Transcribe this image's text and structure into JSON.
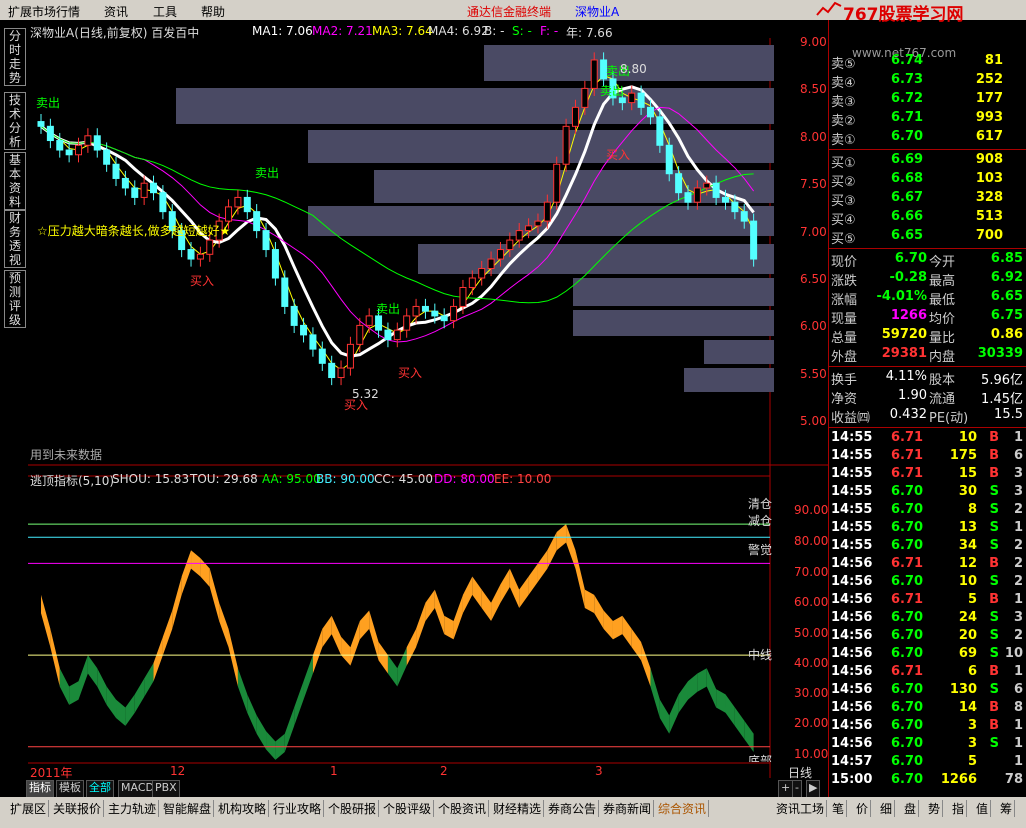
{
  "menu": {
    "items": [
      "扩展市场行情",
      "资讯",
      "工具",
      "帮助"
    ],
    "app_title": "通达信金融终端",
    "stock": "深物业A"
  },
  "logo": {
    "text": "767股票学习网",
    "url": "www.net767.com"
  },
  "side_tabs": [
    "分时走势",
    "技术分析",
    "基本资料",
    "财务透视",
    "预测评级"
  ],
  "chart_header": {
    "title": "深物业A(日线,前复权) 百发百中",
    "ma1": "MA1: 7.06",
    "ma2": "MA2: 7.21",
    "ma3": "MA3: 7.64",
    "ma4": "MA4: 6.92",
    "b": "B: -",
    "s": "S: -",
    "f": "F: -",
    "nian": "年: 7.66"
  },
  "price_axis": [
    "9.00",
    "8.50",
    "8.00",
    "7.50",
    "7.00",
    "6.50",
    "6.00",
    "5.50",
    "5.00"
  ],
  "chart_annotations": {
    "pressure_text": "☆压力越大暗条越长,做多越短越好★",
    "future_data": "用到未来数据",
    "sell": "卖出",
    "buy": "买入",
    "low_price": "5.32",
    "high_price": "8.80"
  },
  "indicator": {
    "header": "逃顶指标(5,10)",
    "shou": "SHOU: 15.83",
    "tou": "TOU: 29.68",
    "aa": "AA: 95.00",
    "bb": "BB: 90.00",
    "cc": "CC: 45.00",
    "dd": "DD: 80.00",
    "ee": "EE: 10.00",
    "levels": [
      "清仓",
      "减仓",
      "警觉",
      "中线",
      "底部"
    ],
    "axis": [
      "90.00",
      "80.00",
      "70.00",
      "60.00",
      "50.00",
      "40.00",
      "30.00",
      "20.00",
      "10.00"
    ]
  },
  "x_axis": {
    "labels": [
      "2011年",
      "12",
      "1",
      "2",
      "3"
    ],
    "period": "日线"
  },
  "bottom_tabs": [
    "指标",
    "模板",
    "全部",
    "MACD",
    "PBX"
  ],
  "footer": [
    "扩展区",
    "关联报价",
    "主力轨迹",
    "智能解盘",
    "机构攻略",
    "行业攻略",
    "个股研报",
    "个股评级",
    "个股资讯",
    "财经精选",
    "券商公告",
    "券商新闻",
    "综合资讯",
    "资讯工场"
  ],
  "footer_right": [
    "笔",
    "价",
    "细",
    "盘",
    "势",
    "指",
    "值",
    "筹"
  ],
  "order_book": {
    "asks": [
      {
        "label": "卖⑤",
        "price": "6.74",
        "vol": "81"
      },
      {
        "label": "卖④",
        "price": "6.73",
        "vol": "252"
      },
      {
        "label": "卖③",
        "price": "6.72",
        "vol": "177"
      },
      {
        "label": "卖②",
        "price": "6.71",
        "vol": "993"
      },
      {
        "label": "卖①",
        "price": "6.70",
        "vol": "617"
      }
    ],
    "bids": [
      {
        "label": "买①",
        "price": "6.69",
        "vol": "908"
      },
      {
        "label": "买②",
        "price": "6.68",
        "vol": "103"
      },
      {
        "label": "买③",
        "price": "6.67",
        "vol": "328"
      },
      {
        "label": "买④",
        "price": "6.66",
        "vol": "513"
      },
      {
        "label": "买⑤",
        "price": "6.65",
        "vol": "700"
      }
    ]
  },
  "stats": [
    {
      "l1": "现价",
      "v1": "6.70",
      "c1": "#0f0",
      "l2": "今开",
      "v2": "6.85",
      "c2": "#0f0"
    },
    {
      "l1": "涨跌",
      "v1": "-0.28",
      "c1": "#0f0",
      "l2": "最高",
      "v2": "6.92",
      "c2": "#0f0"
    },
    {
      "l1": "涨幅",
      "v1": "-4.01%",
      "c1": "#0f0",
      "l2": "最低",
      "v2": "6.65",
      "c2": "#0f0"
    },
    {
      "l1": "现量",
      "v1": "1266",
      "c1": "#f0f",
      "l2": "均价",
      "v2": "6.75",
      "c2": "#0f0"
    },
    {
      "l1": "总量",
      "v1": "59720",
      "c1": "#ff0",
      "l2": "量比",
      "v2": "0.86",
      "c2": "#ff0"
    },
    {
      "l1": "外盘",
      "v1": "29381",
      "c1": "#f33",
      "l2": "内盘",
      "v2": "30339",
      "c2": "#0f0"
    }
  ],
  "stats2": [
    {
      "l1": "换手",
      "v1": "4.11%",
      "l2": "股本",
      "v2": "5.96亿"
    },
    {
      "l1": "净资",
      "v1": "1.90",
      "l2": "流通",
      "v2": "1.45亿"
    },
    {
      "l1": "收益㈣",
      "v1": "0.432",
      "l2": "PE(动)",
      "v2": "15.5"
    }
  ],
  "trades": [
    {
      "t": "14:55",
      "p": "6.71",
      "v": "10",
      "bs": "B",
      "n": "1"
    },
    {
      "t": "14:55",
      "p": "6.71",
      "v": "175",
      "bs": "B",
      "n": "6"
    },
    {
      "t": "14:55",
      "p": "6.71",
      "v": "15",
      "bs": "B",
      "n": "3"
    },
    {
      "t": "14:55",
      "p": "6.70",
      "v": "30",
      "bs": "S",
      "n": "3"
    },
    {
      "t": "14:55",
      "p": "6.70",
      "v": "8",
      "bs": "S",
      "n": "2"
    },
    {
      "t": "14:55",
      "p": "6.70",
      "v": "13",
      "bs": "S",
      "n": "1"
    },
    {
      "t": "14:55",
      "p": "6.70",
      "v": "34",
      "bs": "S",
      "n": "2"
    },
    {
      "t": "14:56",
      "p": "6.71",
      "v": "12",
      "bs": "B",
      "n": "2"
    },
    {
      "t": "14:56",
      "p": "6.70",
      "v": "10",
      "bs": "S",
      "n": "2"
    },
    {
      "t": "14:56",
      "p": "6.71",
      "v": "5",
      "bs": "B",
      "n": "1"
    },
    {
      "t": "14:56",
      "p": "6.70",
      "v": "24",
      "bs": "S",
      "n": "3"
    },
    {
      "t": "14:56",
      "p": "6.70",
      "v": "20",
      "bs": "S",
      "n": "2"
    },
    {
      "t": "14:56",
      "p": "6.70",
      "v": "69",
      "bs": "S",
      "n": "10"
    },
    {
      "t": "14:56",
      "p": "6.71",
      "v": "6",
      "bs": "B",
      "n": "1"
    },
    {
      "t": "14:56",
      "p": "6.70",
      "v": "130",
      "bs": "S",
      "n": "6"
    },
    {
      "t": "14:56",
      "p": "6.70",
      "v": "14",
      "bs": "B",
      "n": "8"
    },
    {
      "t": "14:56",
      "p": "6.70",
      "v": "3",
      "bs": "B",
      "n": "1"
    },
    {
      "t": "14:56",
      "p": "6.70",
      "v": "3",
      "bs": "S",
      "n": "1"
    },
    {
      "t": "14:57",
      "p": "6.70",
      "v": "5",
      "bs": "",
      "n": "1"
    },
    {
      "t": "15:00",
      "p": "6.70",
      "v": "1266",
      "bs": "",
      "n": "78"
    }
  ],
  "colors": {
    "up": "#ff3232",
    "down": "#54ffff",
    "ma1": "#ffffff",
    "ma2": "#ff00ff",
    "ma3": "#ffff00",
    "ma4": "#00ff00",
    "orange": "#ffa020",
    "green": "#1a8a3a"
  }
}
